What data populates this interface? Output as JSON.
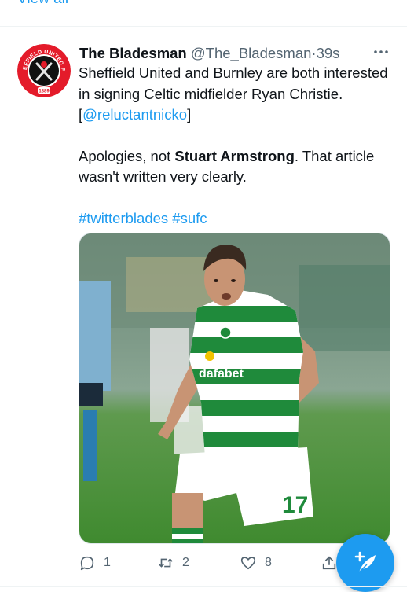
{
  "top": {
    "view_all_label": "View all"
  },
  "tweet": {
    "author_name": "The Bladesman",
    "author_handle": "@The_Bladesman",
    "separator": "·",
    "time": "39s",
    "text_part1": "Sheffield United and Burnley are both interested in signing Celtic midfielder Ryan Christie. [",
    "mention": "@reluctantnicko",
    "text_part2": "]",
    "line2_part1": "Apologies, not ",
    "line2_bold": "Stuart Armstrong",
    "line2_part2": ". That article wasn't written very clearly.",
    "hashtag1": "#twitterblades",
    "hashtag2": "#sufc",
    "media": {
      "shirt_sponsor": "dafabet",
      "shirt_number": "17"
    },
    "avatar": {
      "badge_text_top": "SHEFFIELD UNITED F.C.",
      "badge_year": "1889"
    }
  },
  "actions": {
    "reply_count": "1",
    "retweet_count": "2",
    "like_count": "8"
  },
  "icons": [
    "chevron-right-icon",
    "more-icon",
    "reply-icon",
    "retweet-icon",
    "like-icon",
    "share-icon",
    "compose-icon"
  ],
  "colors": {
    "accent": "#1d9bf0",
    "text": "#0f1419",
    "secondary": "#536471",
    "celtic_green": "#1f8a3b"
  }
}
